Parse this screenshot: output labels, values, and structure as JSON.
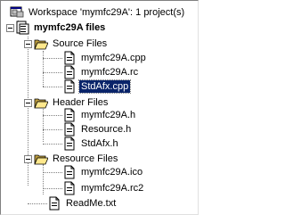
{
  "workspace": {
    "label": "Workspace 'mymfc29A': 1 project(s)",
    "icon": "workspace-icon"
  },
  "project": {
    "label": "mymfc29A files",
    "icon": "project-icon"
  },
  "folders": [
    {
      "label": "Source Files",
      "icon": "folder-open-icon",
      "files": [
        {
          "label": "mymfc29A.cpp",
          "icon": "cpp-file-icon"
        },
        {
          "label": "mymfc29A.rc",
          "icon": "rc-file-icon"
        },
        {
          "label": "StdAfx.cpp",
          "icon": "cpp-file-icon",
          "selected": true
        }
      ]
    },
    {
      "label": "Header Files",
      "icon": "folder-open-icon",
      "files": [
        {
          "label": "mymfc29A.h",
          "icon": "header-file-icon"
        },
        {
          "label": "Resource.h",
          "icon": "header-file-icon"
        },
        {
          "label": "StdAfx.h",
          "icon": "header-file-icon"
        }
      ]
    },
    {
      "label": "Resource Files",
      "icon": "folder-open-icon",
      "files": [
        {
          "label": "mymfc29A.ico",
          "icon": "resource-file-icon"
        },
        {
          "label": "mymfc29A.rc2",
          "icon": "resource-file-icon"
        }
      ]
    }
  ],
  "readme": {
    "label": "ReadMe.txt",
    "icon": "text-file-icon"
  },
  "colors": {
    "selection_bg": "#0a246a",
    "folder_yellow": "#ffe88c"
  }
}
